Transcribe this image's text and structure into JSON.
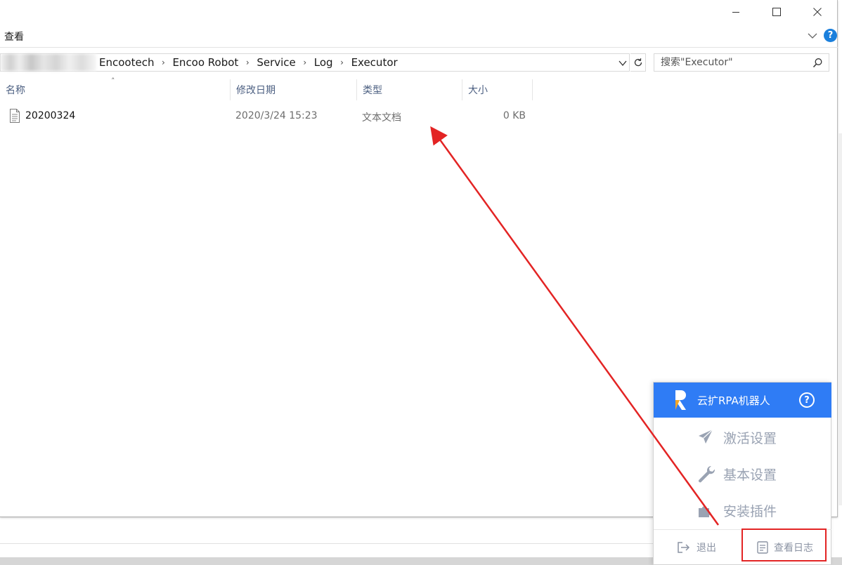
{
  "window": {
    "ribbon_tab": "查看",
    "help_label": "?"
  },
  "address_bar": {
    "crumbs": [
      "Encootech",
      "Encoo Robot",
      "Service",
      "Log",
      "Executor"
    ]
  },
  "search": {
    "placeholder": "搜索\"Executor\""
  },
  "columns": {
    "name": "名称",
    "date": "修改日期",
    "type": "类型",
    "size": "大小"
  },
  "files": [
    {
      "name": "20200324",
      "date": "2020/3/24 15:23",
      "type": "文本文档",
      "size": "0 KB"
    }
  ],
  "popup": {
    "title": "云扩RPA机器人",
    "help_label": "?",
    "menu": [
      {
        "label": "激活设置",
        "icon": "paper-plane-icon"
      },
      {
        "label": "基本设置",
        "icon": "wrench-icon"
      },
      {
        "label": "安装插件",
        "icon": "puzzle-icon"
      }
    ],
    "exit_label": "退出",
    "view_log_label": "查看日志"
  },
  "colors": {
    "popup_header": "#2f7cf5",
    "annotation": "#e32424"
  }
}
